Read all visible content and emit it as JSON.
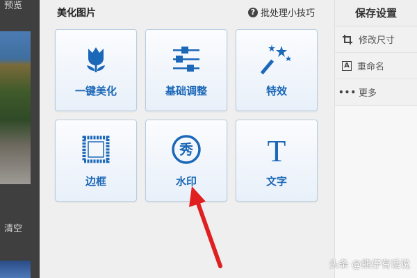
{
  "left": {
    "preview_label": "预览",
    "clear_label": "清空"
  },
  "panel": {
    "title": "美化图片",
    "tips_link": "批处理小技巧"
  },
  "tiles": [
    {
      "label": "一键美化",
      "icon": "tulip-icon"
    },
    {
      "label": "基础调整",
      "icon": "sliders-icon"
    },
    {
      "label": "特效",
      "icon": "magic-wand-icon"
    },
    {
      "label": "边框",
      "icon": "frame-icon"
    },
    {
      "label": "水印",
      "icon": "watermark-seal-icon",
      "seal_char": "秀"
    },
    {
      "label": "文字",
      "icon": "text-icon",
      "glyph": "T"
    }
  ],
  "right": {
    "title": "保存设置",
    "items": [
      {
        "label": "修改尺寸",
        "icon": "crop-icon"
      },
      {
        "label": "重命名",
        "icon": "rename-icon",
        "icon_glyph": "A"
      },
      {
        "label": "更多",
        "icon": "more-icon",
        "icon_glyph": "•••"
      }
    ]
  },
  "watermark": "头条 @熊仔有话说",
  "colors": {
    "accent_blue": "#1b67b8",
    "arrow_red": "#e02020",
    "sidebar_dark": "#3f3f3f",
    "panel_bg": "#efefef"
  }
}
